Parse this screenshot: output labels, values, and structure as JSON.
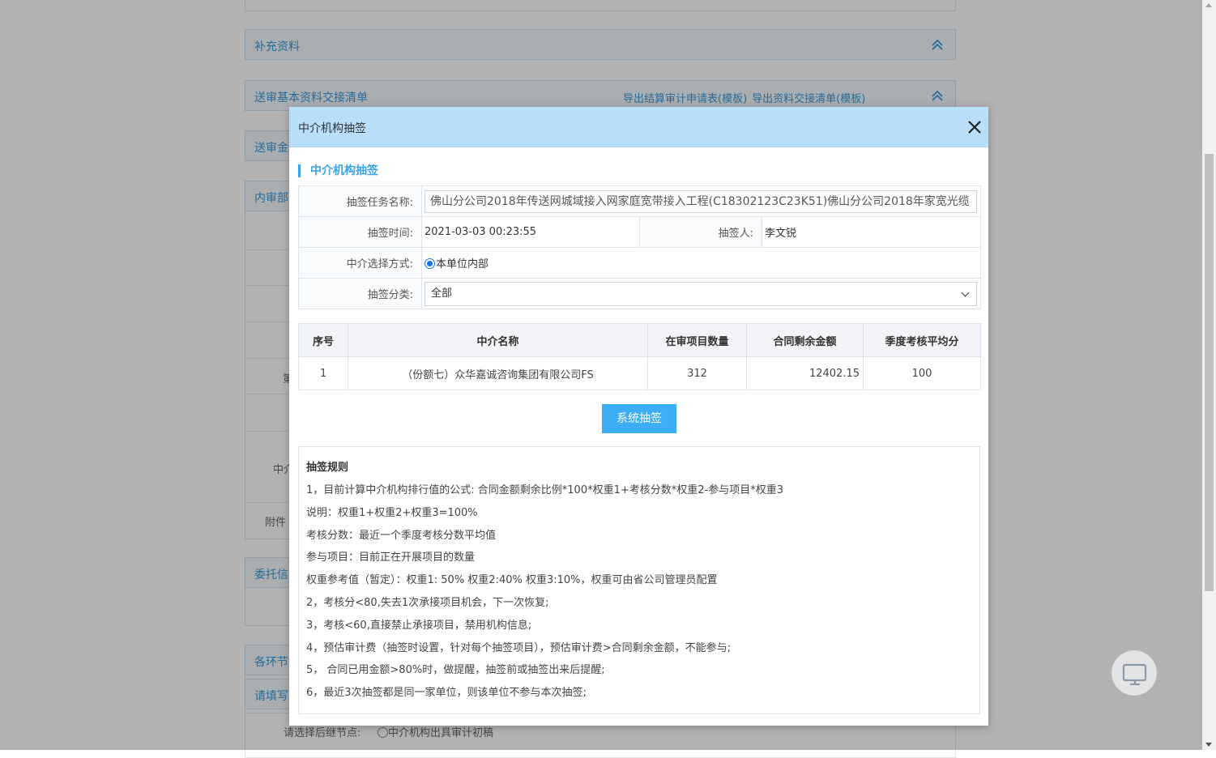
{
  "background": {
    "panels": [
      {
        "title": "补充资料"
      },
      {
        "title": "送审基本资料交接清单",
        "links": [
          "导出结算审计申请表(模板)",
          "导出资料交接清单(模板)"
        ]
      },
      {
        "title": "送审金"
      },
      {
        "title": "内审部"
      },
      {
        "title": "委托信"
      },
      {
        "title": "各环节"
      },
      {
        "title": "请填写"
      }
    ],
    "labels": [
      "第",
      "中介",
      "附件"
    ],
    "bottom_row": {
      "label": "请选择后继节点:",
      "option": "中介机构出具审计初稿"
    }
  },
  "modal": {
    "title": "中介机构抽签",
    "section_title": "中介机构抽签",
    "form": {
      "task_name_label": "抽签任务名称:",
      "task_name_value": "佛山分公司2018年传送网城域接入网家庭宽带接入工程(C18302123C23K51)佛山分公司2018年家宽光缆",
      "draw_time_label": "抽签时间:",
      "draw_time_value": "2021-03-03 00:23:55",
      "drawer_label": "抽签人:",
      "drawer_value": "李文锐",
      "select_mode_label": "中介选择方式:",
      "select_mode_value": "本单位内部",
      "category_label": "抽签分类:",
      "category_value": "全部"
    },
    "table": {
      "headers": [
        "序号",
        "中介名称",
        "在审项目数量",
        "合同剩余金额",
        "季度考核平均分"
      ],
      "rows": [
        [
          "1",
          "（份额七）众华嘉诚咨询集团有限公司FS",
          "312",
          "12402.15",
          "100"
        ]
      ]
    },
    "draw_button": "系统抽签",
    "rules": {
      "title": "抽签规则",
      "lines": [
        "1，目前计算中介机构排行值的公式: 合同金额剩余比例*100*权重1+考核分数*权重2-参与项目*权重3",
        "说明：权重1+权重2+权重3=100%",
        "考核分数：最近一个季度考核分数平均值",
        "参与项目：目前正在开展项目的数量",
        "权重参考值（暂定）：权重1: 50% 权重2:40% 权重3:10%，权重可由省公司管理员配置",
        "2，考核分<80,失去1次承接项目机会，下一次恢复;",
        "3，考核<60,直接禁止承接项目，禁用机构信息;",
        "4，预估审计费（抽签时设置，针对每个抽签项目），预估审计费>合同剩余金额，不能参与;",
        "5， 合同已用金额>80%时，做提醒，抽签前或抽签出来后提醒;",
        "6，最近3次抽签都是同一家单位，则该单位不参与本次抽签;"
      ]
    }
  },
  "colors": {
    "accent": "#3aa3ea",
    "header_bg": "#b8dff9",
    "button_bg": "#3daef5"
  }
}
